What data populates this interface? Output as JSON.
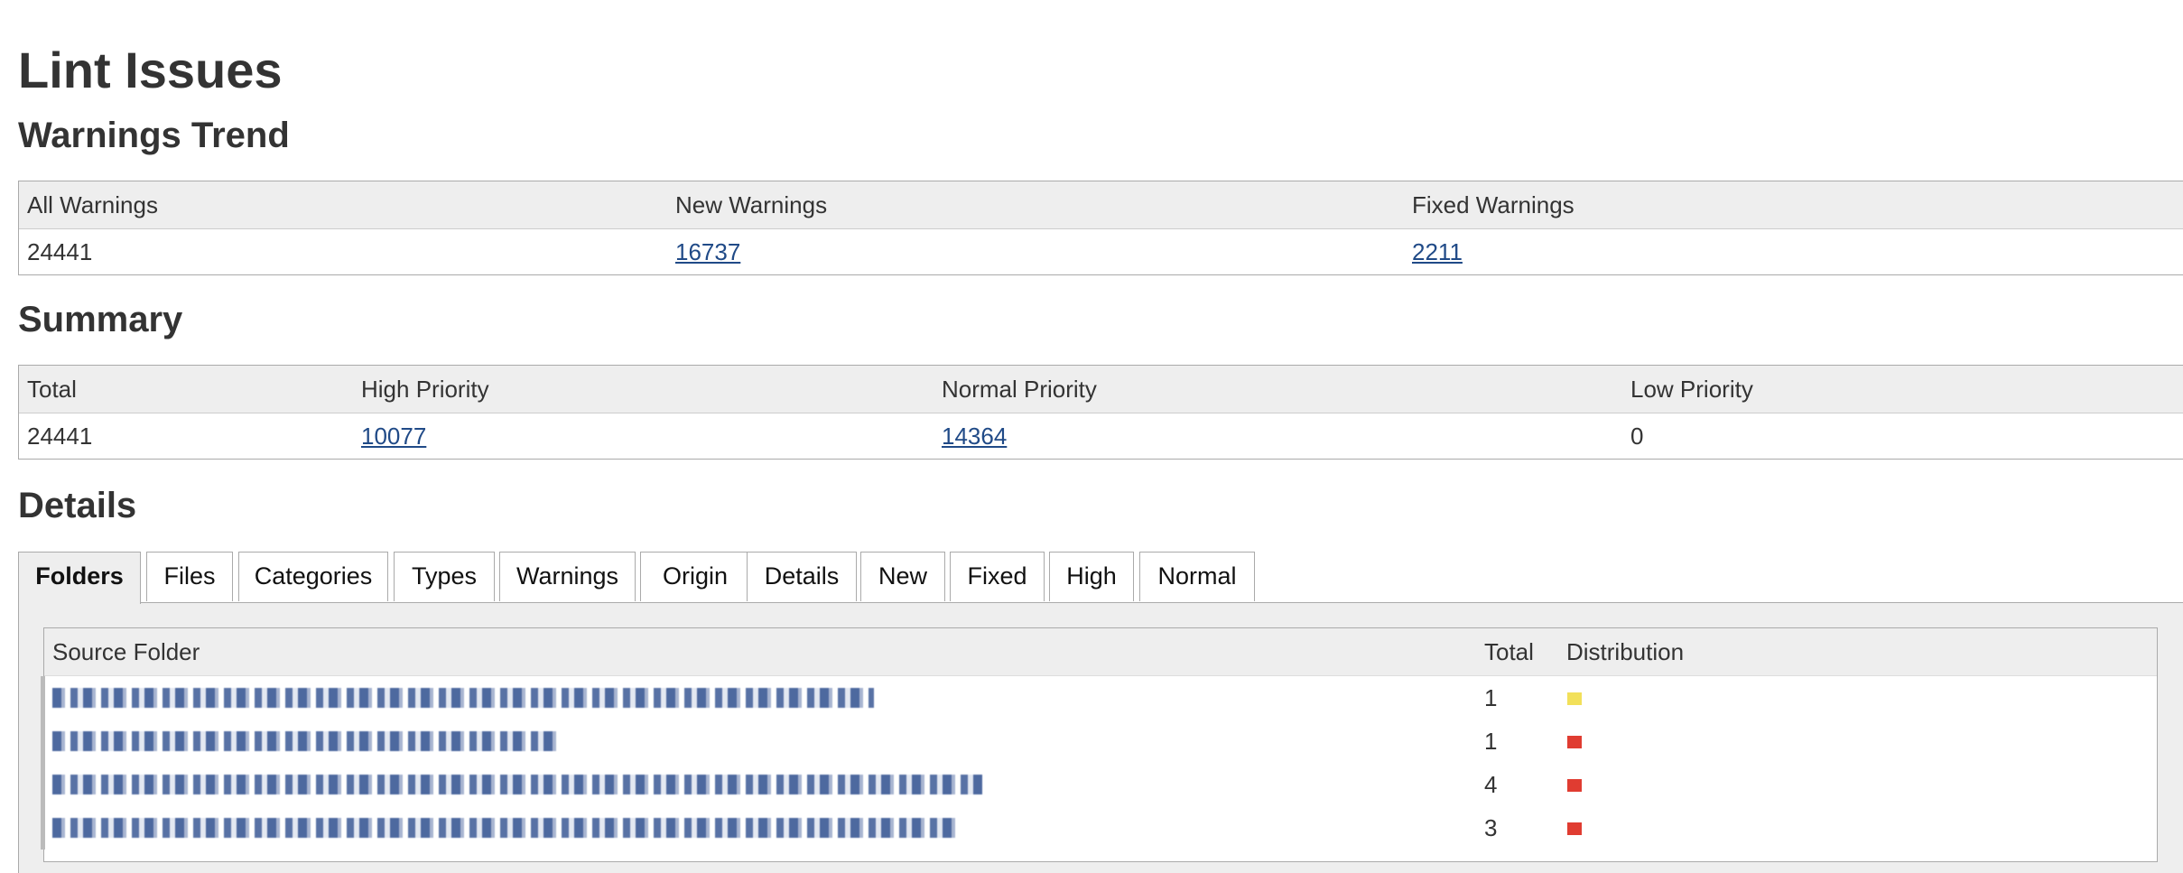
{
  "page_title": "Lint Issues",
  "trend": {
    "heading": "Warnings Trend",
    "headers": [
      "All Warnings",
      "New Warnings",
      "Fixed Warnings"
    ],
    "all": "24441",
    "new": "16737",
    "fixed": "2211"
  },
  "summary": {
    "heading": "Summary",
    "headers": [
      "Total",
      "High Priority",
      "Normal Priority",
      "Low Priority"
    ],
    "total": "24441",
    "high": "10077",
    "normal": "14364",
    "low": "0"
  },
  "details": {
    "heading": "Details",
    "tabs": [
      "Folders",
      "Files",
      "Categories",
      "Types",
      "Warnings",
      "Origin",
      "Details",
      "New",
      "Fixed",
      "High",
      "Normal"
    ],
    "active_tab": "Folders",
    "table": {
      "headers": [
        "Source Folder",
        "Total",
        "Distribution"
      ],
      "rows": [
        {
          "total": "1",
          "distribution_color": "#f2e05a"
        },
        {
          "total": "1",
          "distribution_color": "#e03c31"
        },
        {
          "total": "4",
          "distribution_color": "#e03c31"
        },
        {
          "total": "3",
          "distribution_color": "#e03c31"
        }
      ]
    }
  }
}
